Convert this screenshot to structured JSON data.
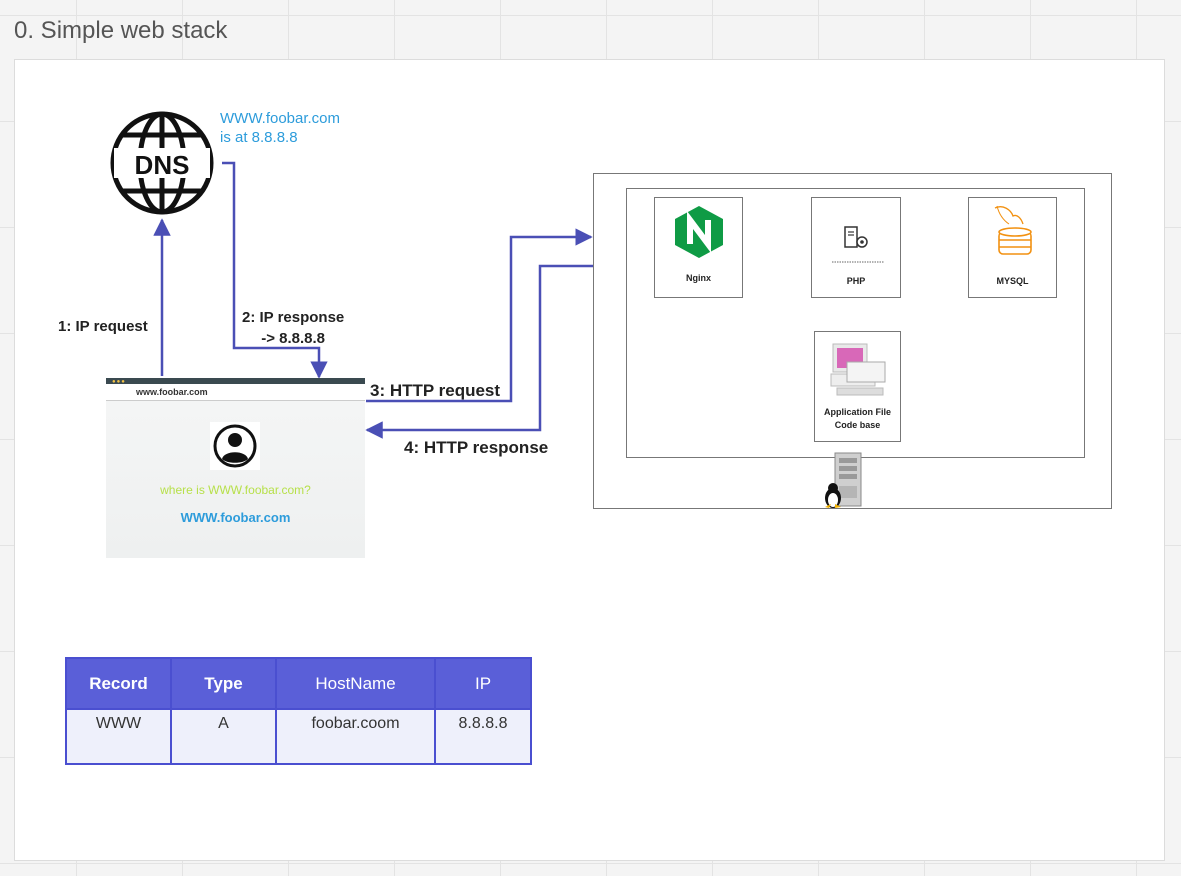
{
  "frame": {
    "title": "0. Simple web stack"
  },
  "dns": {
    "icon_text": "DNS",
    "note_line1": "WWW.foobar.com",
    "note_line2": "is at 8.8.8.8"
  },
  "labels": {
    "ip_request": "1: IP request",
    "ip_response_line1": "2: IP response",
    "ip_response_line2": "-> 8.8.8.8",
    "http_request": "3: HTTP request",
    "http_response": "4: HTTP response"
  },
  "browser": {
    "url": "www.foobar.com",
    "question": "where is WWW.foobar.com?",
    "site": "WWW.foobar.com"
  },
  "server": {
    "nginx_label": "Nginx",
    "php_label": "PHP",
    "mysql_label": "MYSQL",
    "app_label_line1": "Application File",
    "app_label_line2": "Code base"
  },
  "table": {
    "headers": [
      "Record",
      "Type",
      "HostName",
      "IP"
    ],
    "row": [
      "WWW",
      "A",
      "foobar.coom",
      "8.8.8.8"
    ]
  },
  "colors": {
    "arrow": "#4a4fb5",
    "table_header": "#5a5fd8",
    "note_blue": "#2d9cdb",
    "question_green": "#b7e04a",
    "nginx_green": "#0f9b45",
    "mysql_orange": "#f29111"
  }
}
